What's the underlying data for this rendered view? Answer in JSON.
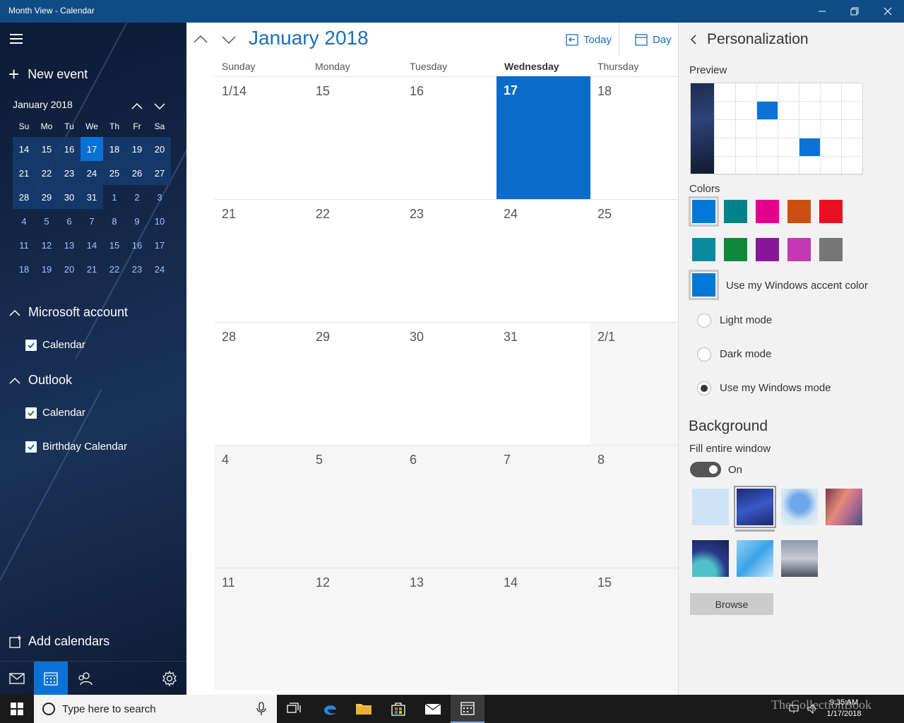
{
  "window": {
    "title": "Month View - Calendar"
  },
  "sidebar": {
    "new_event": "New event",
    "mini_calendar": {
      "title": "January 2018",
      "weekdays": [
        "Su",
        "Mo",
        "Tu",
        "We",
        "Th",
        "Fr",
        "Sa"
      ],
      "rows": [
        [
          "14",
          "15",
          "16",
          "17",
          "18",
          "19",
          "20"
        ],
        [
          "21",
          "22",
          "23",
          "24",
          "25",
          "26",
          "27"
        ],
        [
          "28",
          "29",
          "30",
          "31",
          "1",
          "2",
          "3"
        ],
        [
          "4",
          "5",
          "6",
          "7",
          "8",
          "9",
          "10"
        ],
        [
          "11",
          "12",
          "13",
          "14",
          "15",
          "16",
          "17"
        ],
        [
          "18",
          "19",
          "20",
          "21",
          "22",
          "23",
          "24"
        ]
      ]
    },
    "accounts": [
      {
        "name": "Microsoft account",
        "calendars": [
          {
            "label": "Calendar",
            "color": "#0a72d6",
            "checked": true
          }
        ]
      },
      {
        "name": "Outlook",
        "calendars": [
          {
            "label": "Calendar",
            "color": "#1a8a3c",
            "checked": true
          },
          {
            "label": "Birthday Calendar",
            "color": "#0a72d6",
            "checked": true
          }
        ]
      }
    ],
    "add_calendars": "Add calendars"
  },
  "main": {
    "title": "January 2018",
    "today_button": "Today",
    "view_button": "Day",
    "columns": [
      "Sunday",
      "Monday",
      "Tuesday",
      "Wednesday",
      "Thursday"
    ],
    "weeks": [
      [
        "1/14",
        "15",
        "16",
        "17",
        "18"
      ],
      [
        "21",
        "22",
        "23",
        "24",
        "25"
      ],
      [
        "28",
        "29",
        "30",
        "31",
        "2/1"
      ],
      [
        "4",
        "5",
        "6",
        "7",
        "8"
      ],
      [
        "11",
        "12",
        "13",
        "14",
        "15"
      ]
    ]
  },
  "panel": {
    "title": "Personalization",
    "preview_label": "Preview",
    "colors_label": "Colors",
    "colors": [
      "#0078d7",
      "#038387",
      "#e3008c",
      "#ca5010",
      "#e81123",
      "#0b8a9e",
      "#10893e",
      "#881798",
      "#c239b3",
      "#767676"
    ],
    "accent_color": "#0078d7",
    "use_accent_label": "Use my Windows accent color",
    "modes": [
      {
        "label": "Light mode",
        "selected": false
      },
      {
        "label": "Dark mode",
        "selected": false
      },
      {
        "label": "Use my Windows mode",
        "selected": true
      }
    ],
    "background_title": "Background",
    "fill_label": "Fill entire window",
    "toggle_state": "On",
    "browse_label": "Browse"
  },
  "taskbar": {
    "search_placeholder": "Type here to search",
    "time": "9:35 AM",
    "date": "1/17/2018",
    "watermark": "TheCollectionBook"
  }
}
